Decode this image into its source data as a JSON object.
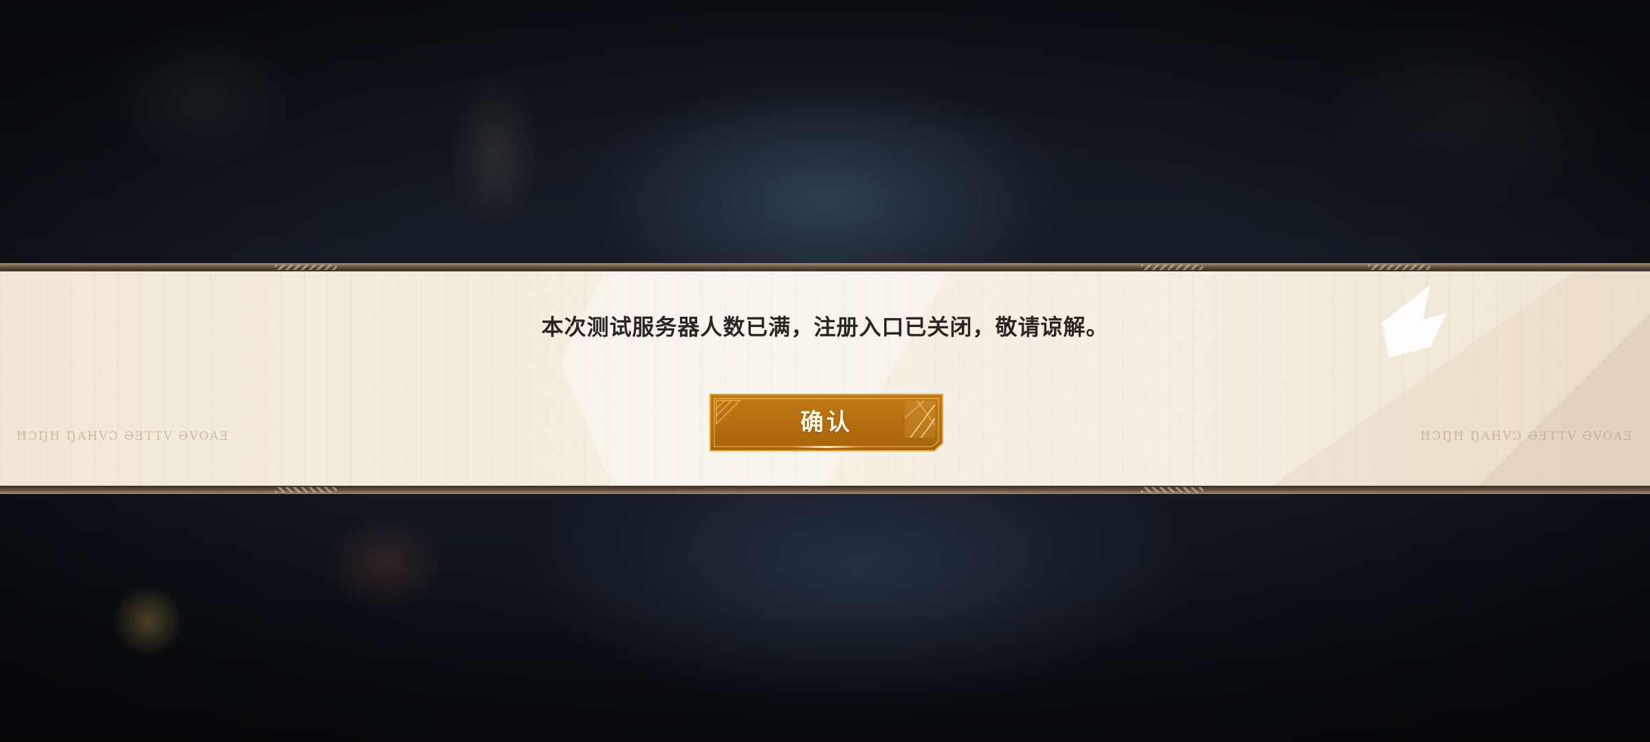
{
  "dialog": {
    "message": "本次测试服务器人数已满，注册入口已关闭，敬请谅解。",
    "confirm_label": "确认",
    "watermark_left": "ĦƆŊĦ ŊAHVƆ ƏƎTTV ƏVOAƎ",
    "watermark_right": "ĦƆŊĦ ŊAHVƆ ƏƎTTV ƏVOAƎ"
  },
  "colors": {
    "panel_bg": "#f4eee3",
    "button_fill": "#b8710f",
    "button_border": "#e8a840",
    "text_dark": "#2b2622",
    "banner_edge": "#5e4a3a"
  },
  "icons": {
    "confirm_corner": "geometric-corner-ornament-icon"
  }
}
